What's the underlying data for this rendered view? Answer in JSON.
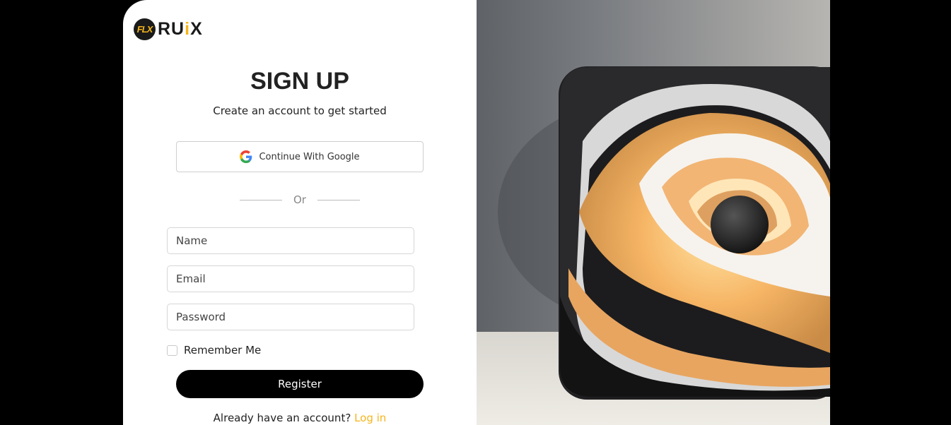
{
  "brand": {
    "badge": "FLX",
    "name_part1": "RU",
    "name_accent": "i",
    "name_part2": "X"
  },
  "heading": {
    "title": "SIGN UP",
    "subtitle": "Create an account to get started"
  },
  "google": {
    "label": "Continue With Google",
    "icon": "google-icon"
  },
  "divider": {
    "label": "Or"
  },
  "form": {
    "name_placeholder": "Name",
    "email_placeholder": "Email",
    "password_placeholder": "Password",
    "remember_label": "Remember Me",
    "remember_checked": false,
    "register_label": "Register"
  },
  "footer": {
    "prompt": "Already have an account?",
    "link": "Log in"
  },
  "colors": {
    "accent": "#f5b51c",
    "primary": "#000000",
    "background": "#000000"
  }
}
